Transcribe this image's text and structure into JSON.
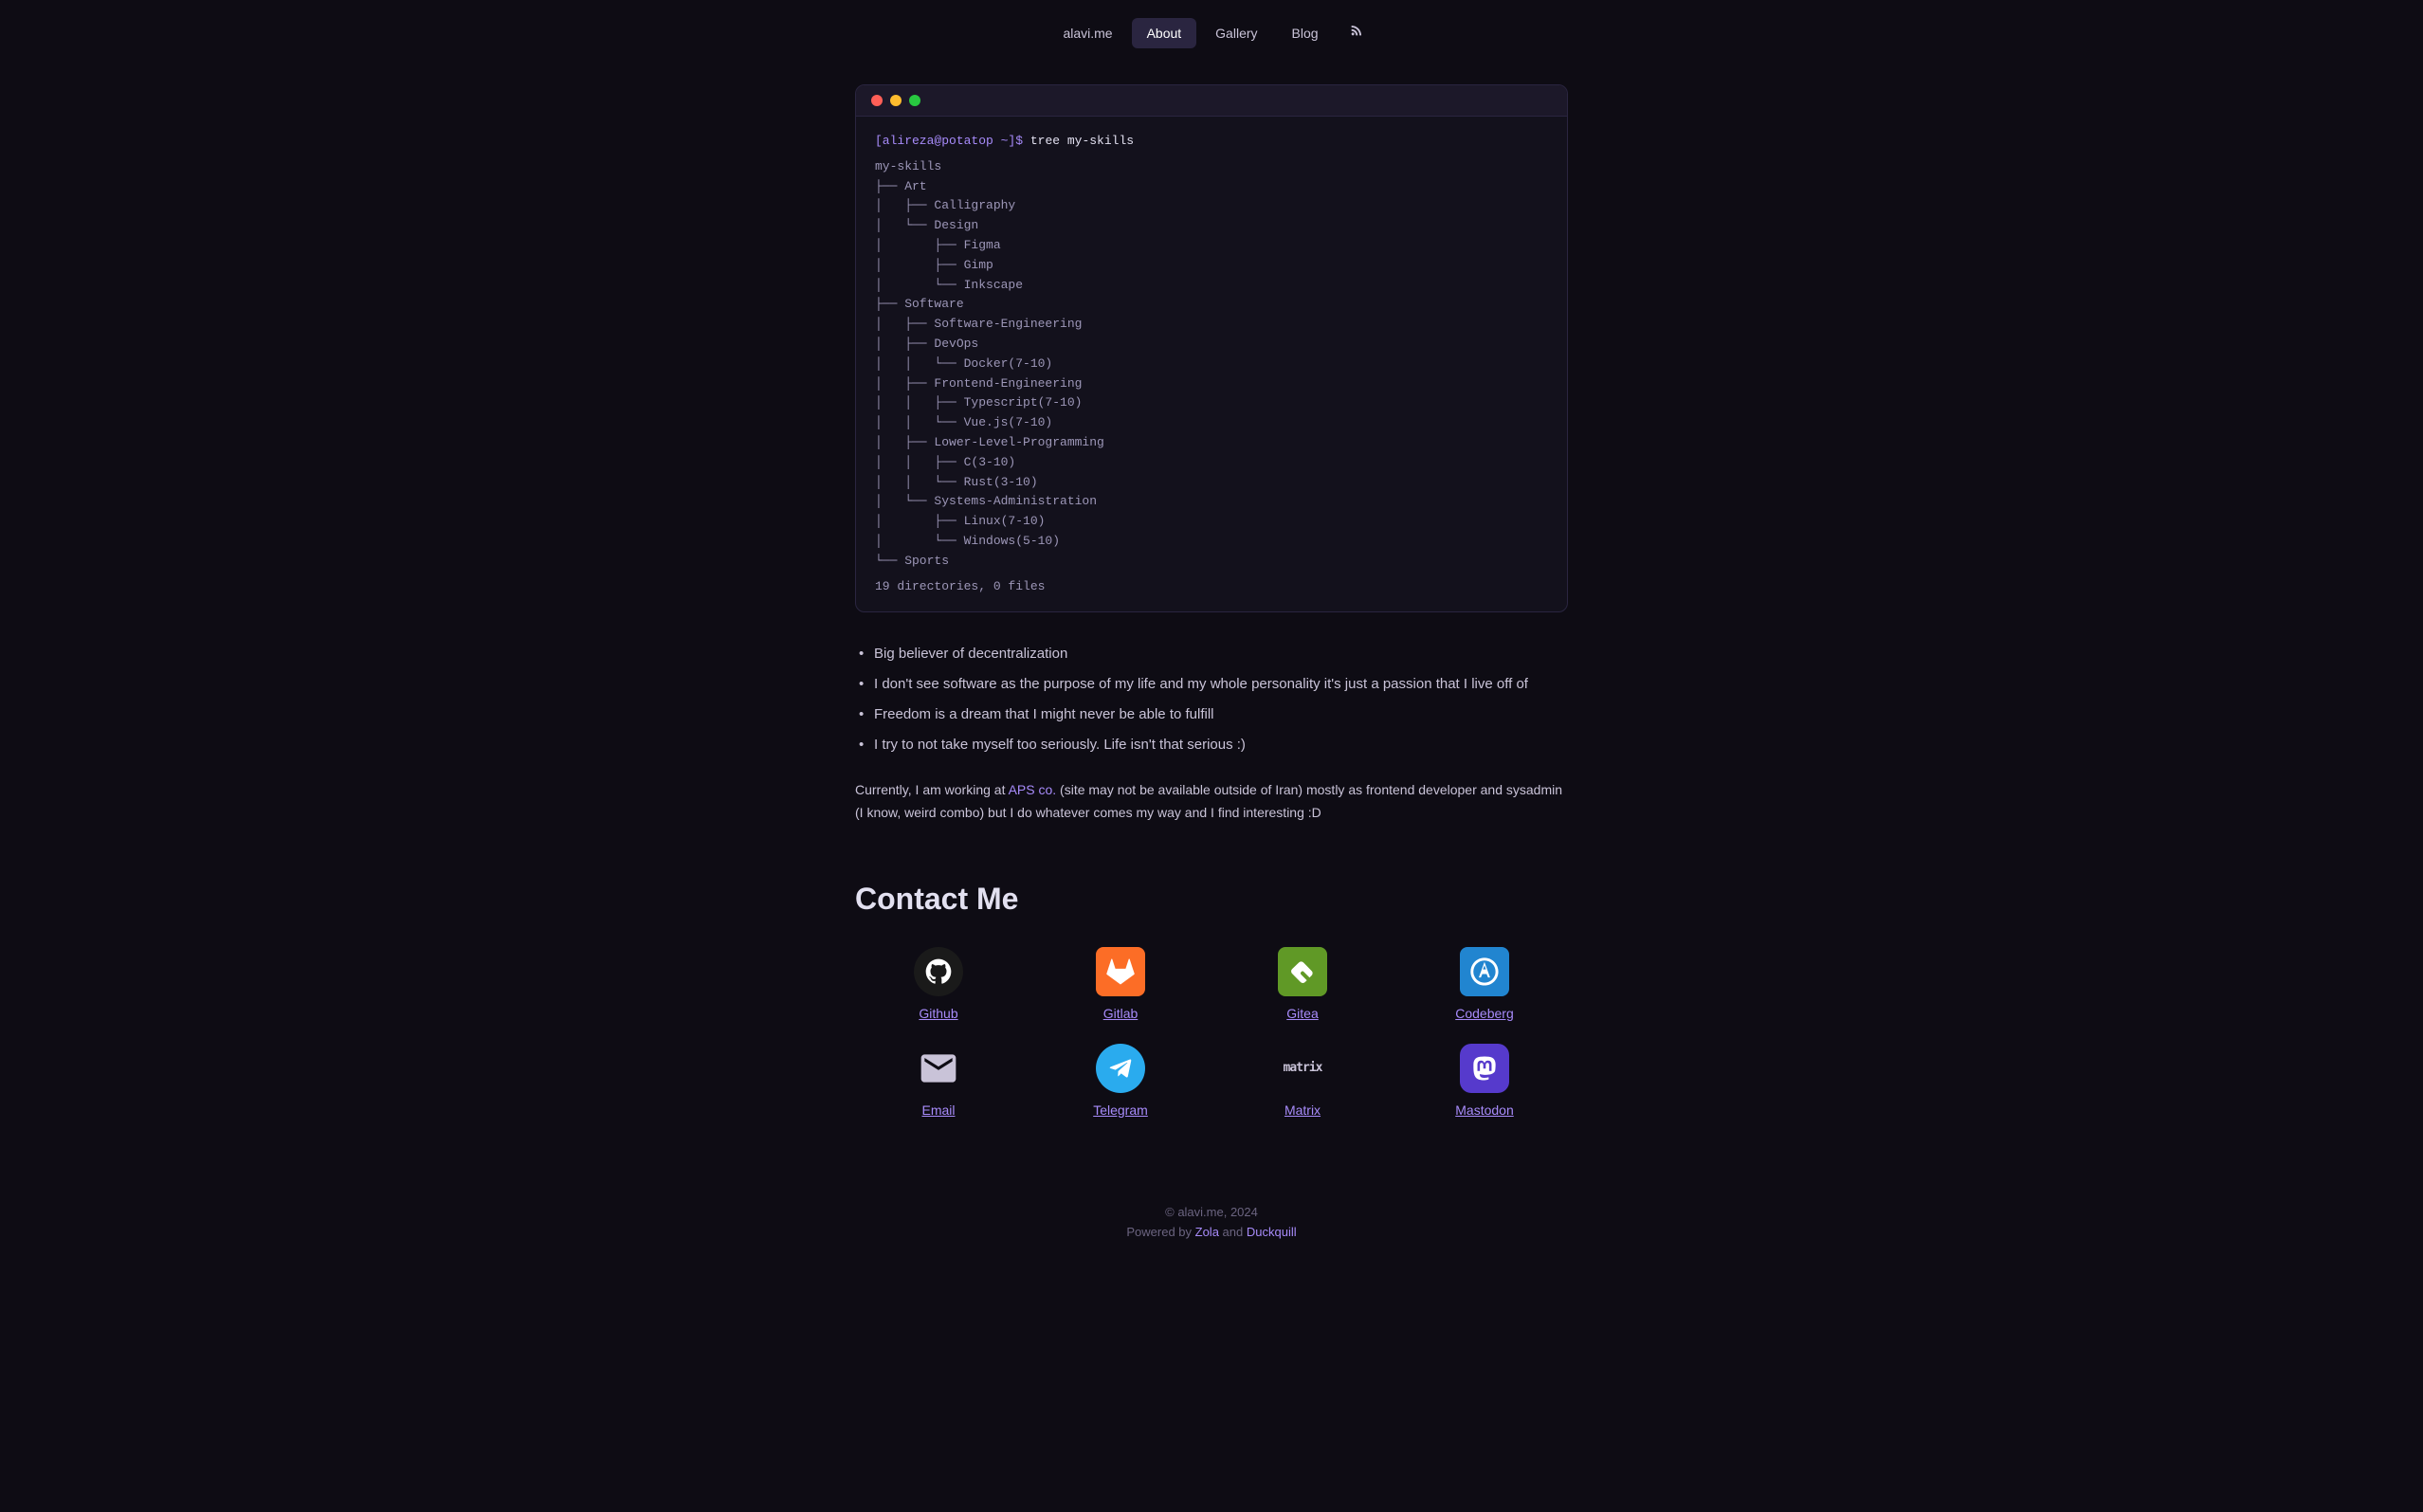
{
  "nav": {
    "items": [
      {
        "id": "alavi-me",
        "label": "alavi.me",
        "active": false
      },
      {
        "id": "about",
        "label": "About",
        "active": true
      },
      {
        "id": "gallery",
        "label": "Gallery",
        "active": false
      },
      {
        "id": "blog",
        "label": "Blog",
        "active": false
      }
    ],
    "rss": "RSS"
  },
  "terminal": {
    "prompt": "[alireza@potatop ~]$ tree my-skills",
    "content": [
      "my-skills",
      "├── Art",
      "│   ├── Calligraphy",
      "│   └── Design",
      "│       ├── Figma",
      "│       ├── Gimp",
      "│       └── Inkscape",
      "├── Software",
      "│   ├── Software-Engineering",
      "│   ├── DevOps",
      "│   │   └── Docker(7-10)",
      "│   ├── Frontend-Engineering",
      "│   │   ├── Typescript(7-10)",
      "│   │   └── Vue.js(7-10)",
      "│   ├── Lower-Level-Programming",
      "│   │   ├── C(3-10)",
      "│   │   └── Rust(3-10)",
      "│   └── Systems-Administration",
      "│       ├── Linux(7-10)",
      "│       └── Windows(5-10)",
      "└── Sports"
    ],
    "stat": "19 directories, 0 files"
  },
  "bullets": [
    "Big believer of decentralization",
    "I don't see software as the purpose of my life and my whole personality it's just a passion that I live off of",
    "Freedom is a dream that I might never be able to fulfill",
    "I try to not take myself too seriously. Life isn't that serious :)"
  ],
  "about_text_1": "Currently, I am working at ",
  "about_link_label": "APS co.",
  "about_link_note": " (site may not be available outside of Iran)",
  "about_text_2": " mostly as frontend developer and sysadmin (I know, weird combo) but I do whatever comes my way and I find interesting :D",
  "contact": {
    "title": "Contact Me",
    "items": [
      {
        "id": "github",
        "label": "Github",
        "icon": "github"
      },
      {
        "id": "gitlab",
        "label": "Gitlab",
        "icon": "gitlab"
      },
      {
        "id": "gitea",
        "label": "Gitea",
        "icon": "gitea"
      },
      {
        "id": "codeberg",
        "label": "Codeberg",
        "icon": "codeberg"
      },
      {
        "id": "email",
        "label": "Email",
        "icon": "email"
      },
      {
        "id": "telegram",
        "label": "Telegram",
        "icon": "telegram"
      },
      {
        "id": "matrix",
        "label": "Matrix",
        "icon": "matrix"
      },
      {
        "id": "mastodon",
        "label": "Mastodon",
        "icon": "mastodon"
      }
    ]
  },
  "footer": {
    "copyright": "© alavi.me, 2024",
    "powered_by": "Powered by ",
    "zola_label": "Zola",
    "and": " and ",
    "duckquill_label": "Duckquill"
  }
}
